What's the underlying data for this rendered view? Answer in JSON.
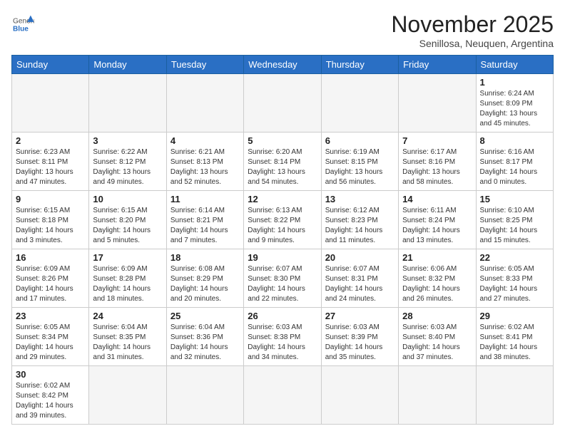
{
  "header": {
    "logo_general": "General",
    "logo_blue": "Blue",
    "month": "November 2025",
    "location": "Senillosa, Neuquen, Argentina"
  },
  "days_of_week": [
    "Sunday",
    "Monday",
    "Tuesday",
    "Wednesday",
    "Thursday",
    "Friday",
    "Saturday"
  ],
  "weeks": [
    [
      {
        "day": "",
        "info": ""
      },
      {
        "day": "",
        "info": ""
      },
      {
        "day": "",
        "info": ""
      },
      {
        "day": "",
        "info": ""
      },
      {
        "day": "",
        "info": ""
      },
      {
        "day": "",
        "info": ""
      },
      {
        "day": "1",
        "info": "Sunrise: 6:24 AM\nSunset: 8:09 PM\nDaylight: 13 hours and 45 minutes."
      }
    ],
    [
      {
        "day": "2",
        "info": "Sunrise: 6:23 AM\nSunset: 8:11 PM\nDaylight: 13 hours and 47 minutes."
      },
      {
        "day": "3",
        "info": "Sunrise: 6:22 AM\nSunset: 8:12 PM\nDaylight: 13 hours and 49 minutes."
      },
      {
        "day": "4",
        "info": "Sunrise: 6:21 AM\nSunset: 8:13 PM\nDaylight: 13 hours and 52 minutes."
      },
      {
        "day": "5",
        "info": "Sunrise: 6:20 AM\nSunset: 8:14 PM\nDaylight: 13 hours and 54 minutes."
      },
      {
        "day": "6",
        "info": "Sunrise: 6:19 AM\nSunset: 8:15 PM\nDaylight: 13 hours and 56 minutes."
      },
      {
        "day": "7",
        "info": "Sunrise: 6:17 AM\nSunset: 8:16 PM\nDaylight: 13 hours and 58 minutes."
      },
      {
        "day": "8",
        "info": "Sunrise: 6:16 AM\nSunset: 8:17 PM\nDaylight: 14 hours and 0 minutes."
      }
    ],
    [
      {
        "day": "9",
        "info": "Sunrise: 6:15 AM\nSunset: 8:18 PM\nDaylight: 14 hours and 3 minutes."
      },
      {
        "day": "10",
        "info": "Sunrise: 6:15 AM\nSunset: 8:20 PM\nDaylight: 14 hours and 5 minutes."
      },
      {
        "day": "11",
        "info": "Sunrise: 6:14 AM\nSunset: 8:21 PM\nDaylight: 14 hours and 7 minutes."
      },
      {
        "day": "12",
        "info": "Sunrise: 6:13 AM\nSunset: 8:22 PM\nDaylight: 14 hours and 9 minutes."
      },
      {
        "day": "13",
        "info": "Sunrise: 6:12 AM\nSunset: 8:23 PM\nDaylight: 14 hours and 11 minutes."
      },
      {
        "day": "14",
        "info": "Sunrise: 6:11 AM\nSunset: 8:24 PM\nDaylight: 14 hours and 13 minutes."
      },
      {
        "day": "15",
        "info": "Sunrise: 6:10 AM\nSunset: 8:25 PM\nDaylight: 14 hours and 15 minutes."
      }
    ],
    [
      {
        "day": "16",
        "info": "Sunrise: 6:09 AM\nSunset: 8:26 PM\nDaylight: 14 hours and 17 minutes."
      },
      {
        "day": "17",
        "info": "Sunrise: 6:09 AM\nSunset: 8:28 PM\nDaylight: 14 hours and 18 minutes."
      },
      {
        "day": "18",
        "info": "Sunrise: 6:08 AM\nSunset: 8:29 PM\nDaylight: 14 hours and 20 minutes."
      },
      {
        "day": "19",
        "info": "Sunrise: 6:07 AM\nSunset: 8:30 PM\nDaylight: 14 hours and 22 minutes."
      },
      {
        "day": "20",
        "info": "Sunrise: 6:07 AM\nSunset: 8:31 PM\nDaylight: 14 hours and 24 minutes."
      },
      {
        "day": "21",
        "info": "Sunrise: 6:06 AM\nSunset: 8:32 PM\nDaylight: 14 hours and 26 minutes."
      },
      {
        "day": "22",
        "info": "Sunrise: 6:05 AM\nSunset: 8:33 PM\nDaylight: 14 hours and 27 minutes."
      }
    ],
    [
      {
        "day": "23",
        "info": "Sunrise: 6:05 AM\nSunset: 8:34 PM\nDaylight: 14 hours and 29 minutes."
      },
      {
        "day": "24",
        "info": "Sunrise: 6:04 AM\nSunset: 8:35 PM\nDaylight: 14 hours and 31 minutes."
      },
      {
        "day": "25",
        "info": "Sunrise: 6:04 AM\nSunset: 8:36 PM\nDaylight: 14 hours and 32 minutes."
      },
      {
        "day": "26",
        "info": "Sunrise: 6:03 AM\nSunset: 8:38 PM\nDaylight: 14 hours and 34 minutes."
      },
      {
        "day": "27",
        "info": "Sunrise: 6:03 AM\nSunset: 8:39 PM\nDaylight: 14 hours and 35 minutes."
      },
      {
        "day": "28",
        "info": "Sunrise: 6:03 AM\nSunset: 8:40 PM\nDaylight: 14 hours and 37 minutes."
      },
      {
        "day": "29",
        "info": "Sunrise: 6:02 AM\nSunset: 8:41 PM\nDaylight: 14 hours and 38 minutes."
      }
    ],
    [
      {
        "day": "30",
        "info": "Sunrise: 6:02 AM\nSunset: 8:42 PM\nDaylight: 14 hours and 39 minutes."
      },
      {
        "day": "",
        "info": ""
      },
      {
        "day": "",
        "info": ""
      },
      {
        "day": "",
        "info": ""
      },
      {
        "day": "",
        "info": ""
      },
      {
        "day": "",
        "info": ""
      },
      {
        "day": "",
        "info": ""
      }
    ]
  ]
}
